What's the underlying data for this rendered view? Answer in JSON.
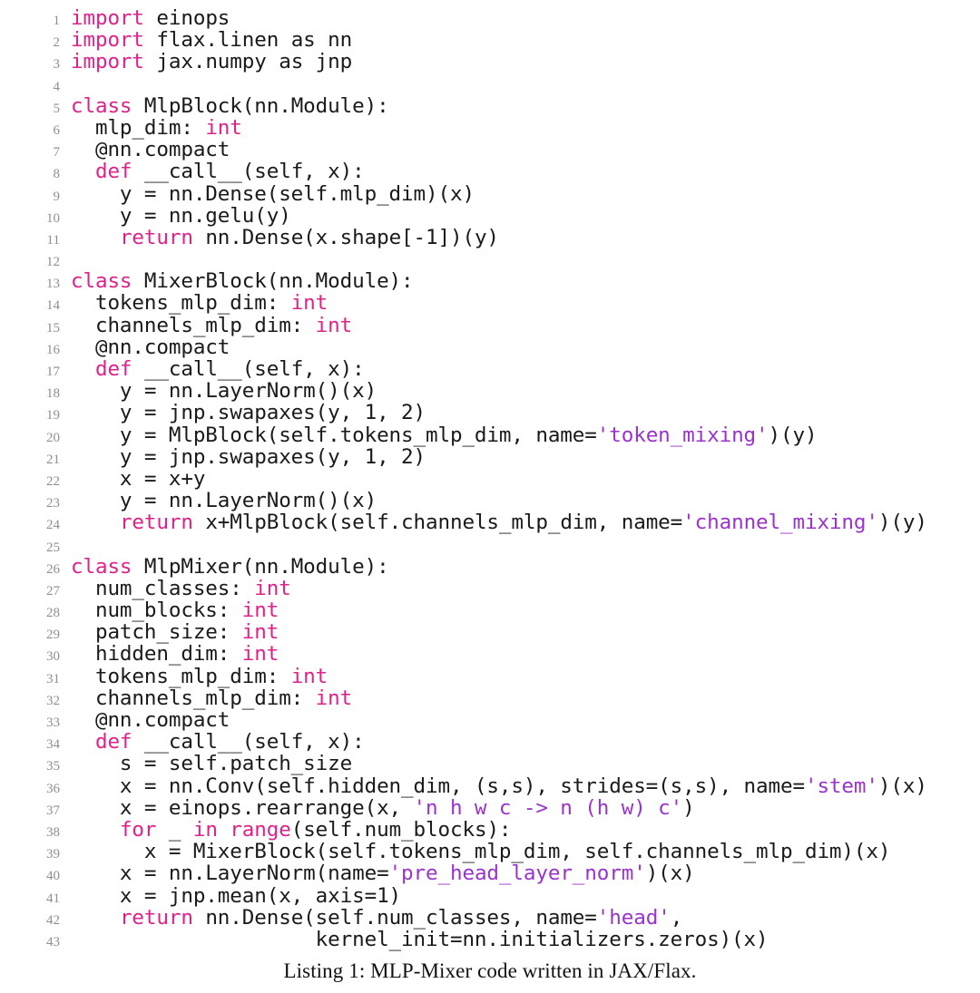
{
  "document": {
    "type": "code-listing",
    "language": "python",
    "caption": "Listing 1: MLP-Mixer code written in JAX/Flax.",
    "colors": {
      "background": "#ffffff",
      "code_text": "#1a1a1a",
      "keyword": "#e0218a",
      "string": "#9a32cd",
      "line_number": "#8e8e93"
    },
    "line_count": 43,
    "first_line_number": 1
  },
  "code": {
    "lines": [
      {
        "n": "1",
        "tokens": [
          {
            "t": "kw",
            "s": "import"
          },
          {
            "t": "pl",
            "s": " einops"
          }
        ]
      },
      {
        "n": "2",
        "tokens": [
          {
            "t": "kw",
            "s": "import"
          },
          {
            "t": "pl",
            "s": " flax.linen as nn"
          }
        ]
      },
      {
        "n": "3",
        "tokens": [
          {
            "t": "kw",
            "s": "import"
          },
          {
            "t": "pl",
            "s": " jax.numpy as jnp"
          }
        ]
      },
      {
        "n": "4",
        "tokens": []
      },
      {
        "n": "5",
        "tokens": [
          {
            "t": "kw",
            "s": "class"
          },
          {
            "t": "pl",
            "s": " MlpBlock(nn.Module):"
          }
        ]
      },
      {
        "n": "6",
        "tokens": [
          {
            "t": "pl",
            "s": "  mlp_dim: "
          },
          {
            "t": "kw",
            "s": "int"
          }
        ]
      },
      {
        "n": "7",
        "tokens": [
          {
            "t": "pl",
            "s": "  @nn.compact"
          }
        ]
      },
      {
        "n": "8",
        "tokens": [
          {
            "t": "pl",
            "s": "  "
          },
          {
            "t": "kw",
            "s": "def"
          },
          {
            "t": "pl",
            "s": " __call__(self, x):"
          }
        ]
      },
      {
        "n": "9",
        "tokens": [
          {
            "t": "pl",
            "s": "    y = nn.Dense(self.mlp_dim)(x)"
          }
        ]
      },
      {
        "n": "10",
        "tokens": [
          {
            "t": "pl",
            "s": "    y = nn.gelu(y)"
          }
        ]
      },
      {
        "n": "11",
        "tokens": [
          {
            "t": "pl",
            "s": "    "
          },
          {
            "t": "kw",
            "s": "return"
          },
          {
            "t": "pl",
            "s": " nn.Dense(x.shape[-1])(y)"
          }
        ]
      },
      {
        "n": "12",
        "tokens": []
      },
      {
        "n": "13",
        "tokens": [
          {
            "t": "kw",
            "s": "class"
          },
          {
            "t": "pl",
            "s": " MixerBlock(nn.Module):"
          }
        ]
      },
      {
        "n": "14",
        "tokens": [
          {
            "t": "pl",
            "s": "  tokens_mlp_dim: "
          },
          {
            "t": "kw",
            "s": "int"
          }
        ]
      },
      {
        "n": "15",
        "tokens": [
          {
            "t": "pl",
            "s": "  channels_mlp_dim: "
          },
          {
            "t": "kw",
            "s": "int"
          }
        ]
      },
      {
        "n": "16",
        "tokens": [
          {
            "t": "pl",
            "s": "  @nn.compact"
          }
        ]
      },
      {
        "n": "17",
        "tokens": [
          {
            "t": "pl",
            "s": "  "
          },
          {
            "t": "kw",
            "s": "def"
          },
          {
            "t": "pl",
            "s": " __call__(self, x):"
          }
        ]
      },
      {
        "n": "18",
        "tokens": [
          {
            "t": "pl",
            "s": "    y = nn.LayerNorm()(x)"
          }
        ]
      },
      {
        "n": "19",
        "tokens": [
          {
            "t": "pl",
            "s": "    y = jnp.swapaxes(y, 1, 2)"
          }
        ]
      },
      {
        "n": "20",
        "tokens": [
          {
            "t": "pl",
            "s": "    y = MlpBlock(self.tokens_mlp_dim, name="
          },
          {
            "t": "str",
            "s": "'token_mixing'"
          },
          {
            "t": "pl",
            "s": ")(y)"
          }
        ]
      },
      {
        "n": "21",
        "tokens": [
          {
            "t": "pl",
            "s": "    y = jnp.swapaxes(y, 1, 2)"
          }
        ]
      },
      {
        "n": "22",
        "tokens": [
          {
            "t": "pl",
            "s": "    x = x+y"
          }
        ]
      },
      {
        "n": "23",
        "tokens": [
          {
            "t": "pl",
            "s": "    y = nn.LayerNorm()(x)"
          }
        ]
      },
      {
        "n": "24",
        "tokens": [
          {
            "t": "pl",
            "s": "    "
          },
          {
            "t": "kw",
            "s": "return"
          },
          {
            "t": "pl",
            "s": " x+MlpBlock(self.channels_mlp_dim, name="
          },
          {
            "t": "str",
            "s": "'channel_mixing'"
          },
          {
            "t": "pl",
            "s": ")(y)"
          }
        ]
      },
      {
        "n": "25",
        "tokens": []
      },
      {
        "n": "26",
        "tokens": [
          {
            "t": "kw",
            "s": "class"
          },
          {
            "t": "pl",
            "s": " MlpMixer(nn.Module):"
          }
        ]
      },
      {
        "n": "27",
        "tokens": [
          {
            "t": "pl",
            "s": "  num_classes: "
          },
          {
            "t": "kw",
            "s": "int"
          }
        ]
      },
      {
        "n": "28",
        "tokens": [
          {
            "t": "pl",
            "s": "  num_blocks: "
          },
          {
            "t": "kw",
            "s": "int"
          }
        ]
      },
      {
        "n": "29",
        "tokens": [
          {
            "t": "pl",
            "s": "  patch_size: "
          },
          {
            "t": "kw",
            "s": "int"
          }
        ]
      },
      {
        "n": "30",
        "tokens": [
          {
            "t": "pl",
            "s": "  hidden_dim: "
          },
          {
            "t": "kw",
            "s": "int"
          }
        ]
      },
      {
        "n": "31",
        "tokens": [
          {
            "t": "pl",
            "s": "  tokens_mlp_dim: "
          },
          {
            "t": "kw",
            "s": "int"
          }
        ]
      },
      {
        "n": "32",
        "tokens": [
          {
            "t": "pl",
            "s": "  channels_mlp_dim: "
          },
          {
            "t": "kw",
            "s": "int"
          }
        ]
      },
      {
        "n": "33",
        "tokens": [
          {
            "t": "pl",
            "s": "  @nn.compact"
          }
        ]
      },
      {
        "n": "34",
        "tokens": [
          {
            "t": "pl",
            "s": "  "
          },
          {
            "t": "kw",
            "s": "def"
          },
          {
            "t": "pl",
            "s": " __call__(self, x):"
          }
        ]
      },
      {
        "n": "35",
        "tokens": [
          {
            "t": "pl",
            "s": "    s = self.patch_size"
          }
        ]
      },
      {
        "n": "36",
        "tokens": [
          {
            "t": "pl",
            "s": "    x = nn.Conv(self.hidden_dim, (s,s), strides=(s,s), name="
          },
          {
            "t": "str",
            "s": "'stem'"
          },
          {
            "t": "pl",
            "s": ")(x)"
          }
        ]
      },
      {
        "n": "37",
        "tokens": [
          {
            "t": "pl",
            "s": "    x = einops.rearrange(x, "
          },
          {
            "t": "str",
            "s": "'n h w c -> n (h w) c'"
          },
          {
            "t": "pl",
            "s": ")"
          }
        ]
      },
      {
        "n": "38",
        "tokens": [
          {
            "t": "pl",
            "s": "    "
          },
          {
            "t": "kw",
            "s": "for"
          },
          {
            "t": "pl",
            "s": " _ "
          },
          {
            "t": "kw",
            "s": "in"
          },
          {
            "t": "pl",
            "s": " "
          },
          {
            "t": "kw",
            "s": "range"
          },
          {
            "t": "pl",
            "s": "(self.num_blocks):"
          }
        ]
      },
      {
        "n": "39",
        "tokens": [
          {
            "t": "pl",
            "s": "      x = MixerBlock(self.tokens_mlp_dim, self.channels_mlp_dim)(x)"
          }
        ]
      },
      {
        "n": "40",
        "tokens": [
          {
            "t": "pl",
            "s": "    x = nn.LayerNorm(name="
          },
          {
            "t": "str",
            "s": "'pre_head_layer_norm'"
          },
          {
            "t": "pl",
            "s": ")(x)"
          }
        ]
      },
      {
        "n": "41",
        "tokens": [
          {
            "t": "pl",
            "s": "    x = jnp.mean(x, axis=1)"
          }
        ]
      },
      {
        "n": "42",
        "tokens": [
          {
            "t": "pl",
            "s": "    "
          },
          {
            "t": "kw",
            "s": "return"
          },
          {
            "t": "pl",
            "s": " nn.Dense(self.num_classes, name="
          },
          {
            "t": "str",
            "s": "'head'"
          },
          {
            "t": "pl",
            "s": ","
          }
        ]
      },
      {
        "n": "43",
        "tokens": [
          {
            "t": "pl",
            "s": "                    kernel_init=nn.initializers.zeros)(x)"
          }
        ]
      }
    ]
  }
}
